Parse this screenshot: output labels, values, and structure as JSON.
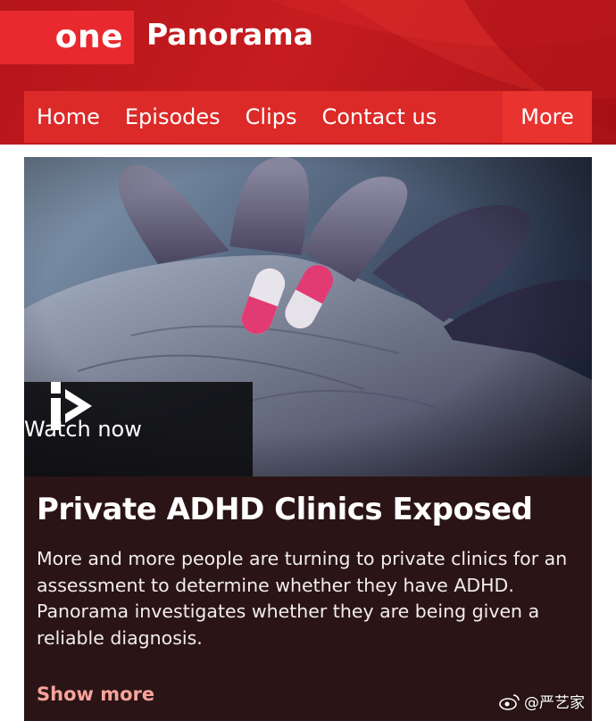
{
  "header": {
    "logo": "one",
    "title": "Panorama",
    "colors": {
      "bar": "#c61c20",
      "logo_bg": "#e82a2e",
      "nav_bg": "#dc2a28"
    }
  },
  "nav": {
    "items": [
      "Home",
      "Episodes",
      "Clips",
      "Contact us"
    ],
    "more": "More"
  },
  "hero": {
    "image": "hand-holding-pills-image",
    "watch_label": "Watch now",
    "watch_icon": "iplayer-play-icon"
  },
  "episode": {
    "title": "Private ADHD Clinics Exposed",
    "description": "More and more people are turning to private clinics for an assessment to determine whether they have ADHD. Panorama investigates whether they are being given a reliable diagnosis.",
    "show_more": "Show more",
    "colors": {
      "card_bg": "#2b1416",
      "show_more": "#f6a39b"
    }
  },
  "watermark": {
    "icon": "weibo-icon",
    "text": "@严艺家"
  }
}
